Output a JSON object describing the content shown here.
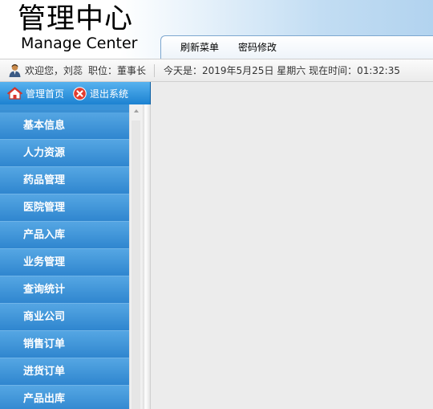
{
  "header": {
    "title_cn": "管理中心",
    "title_en": "Manage Center",
    "nav": [
      {
        "label": "刷新菜单"
      },
      {
        "label": "密码修改"
      }
    ]
  },
  "infobar": {
    "welcome": "欢迎您，刘蕊",
    "role": "职位：董事长",
    "datetime": "今天是：2019年5月25日 星期六 现在时间：01:32:35"
  },
  "sidebar": {
    "home_label": "管理首页",
    "logout_label": "退出系统",
    "items": [
      {
        "label": "基本信息"
      },
      {
        "label": "人力资源"
      },
      {
        "label": "药品管理"
      },
      {
        "label": "医院管理"
      },
      {
        "label": "产品入库"
      },
      {
        "label": "业务管理"
      },
      {
        "label": "查询统计"
      },
      {
        "label": "商业公司"
      },
      {
        "label": "销售订单"
      },
      {
        "label": "进货订单"
      },
      {
        "label": "产品出库"
      }
    ]
  },
  "icons": {
    "user": "user-icon",
    "home": "home-icon",
    "logout": "logout-icon"
  },
  "colors": {
    "menu_blue": "#2f86cf",
    "menu_text": "#ffffff",
    "logout_red": "#e23b2e"
  }
}
